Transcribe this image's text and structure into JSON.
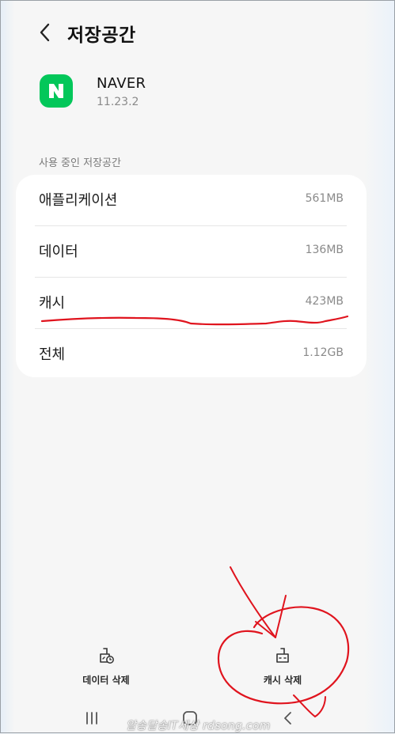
{
  "header": {
    "title": "저장공간",
    "back_icon": "chevron-left-icon"
  },
  "app": {
    "name": "NAVER",
    "version": "11.23.2",
    "icon_letter": "N",
    "icon_color": "#03c75a"
  },
  "section_label": "사용 중인 저장공간",
  "storage_rows": [
    {
      "label": "애플리케이션",
      "value": "561MB"
    },
    {
      "label": "데이터",
      "value": "136MB"
    },
    {
      "label": "캐시",
      "value": "423MB"
    },
    {
      "label": "전체",
      "value": "1.12GB"
    }
  ],
  "actions": {
    "clear_data": {
      "label": "데이터 삭제",
      "icon": "broom-clock-icon"
    },
    "clear_cache": {
      "label": "캐시 삭제",
      "icon": "broom-icon"
    }
  },
  "navigation": {
    "recents_icon": "recents-icon",
    "home_icon": "home-icon",
    "back_icon": "back-icon"
  },
  "watermark": "알송달송IT세상 rdsong.com",
  "annotation_color": "#e0141e"
}
